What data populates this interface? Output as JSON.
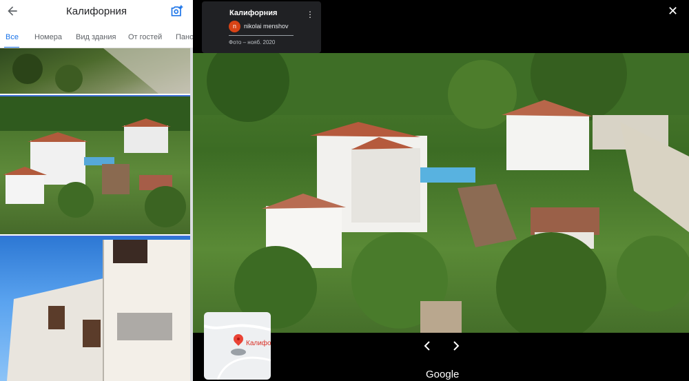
{
  "header": {
    "title": "Калифорния"
  },
  "tabs": [
    "Все",
    "Номера",
    "Вид здания",
    "От гостей",
    "Панорамы"
  ],
  "info_card": {
    "title": "Калифорния",
    "author_initial": "n",
    "author": "nikolai menshov",
    "date": "Фото – нояб. 2020"
  },
  "minimap": {
    "label": "Калифорния"
  },
  "footer": {
    "brand": "Google"
  },
  "icons": {
    "back": "arrow-left-icon",
    "add_photo": "camera-add-icon",
    "more": "more-vert-icon",
    "close": "close-icon",
    "prev": "chevron-left-icon",
    "next": "chevron-right-icon",
    "collapse": "chevron-left-icon"
  },
  "colors": {
    "accent": "#1a73e8",
    "pin": "#ea4335",
    "panel": "#202124"
  }
}
